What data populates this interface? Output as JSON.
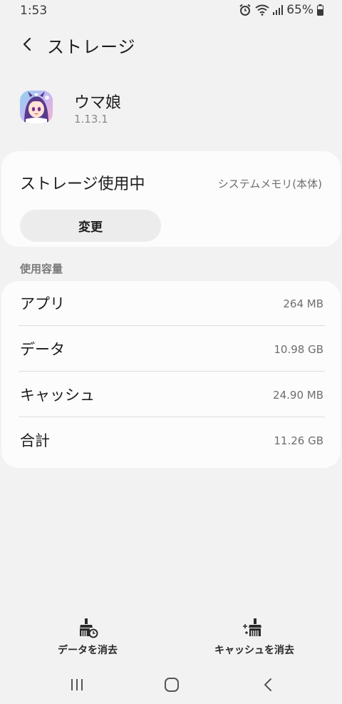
{
  "status_bar": {
    "time": "1:53",
    "battery_text": "65%",
    "icons": [
      "alarm-icon",
      "wifi-icon",
      "signal-icon",
      "battery-icon"
    ]
  },
  "header": {
    "title": "ストレージ",
    "back_icon": "chevron-left-icon"
  },
  "app": {
    "name": "ウマ娘",
    "version": "1.13.1"
  },
  "storage": {
    "label": "ストレージ使用中",
    "value": "システムメモリ(本体)",
    "change_button": "変更"
  },
  "usage": {
    "section_title": "使用容量",
    "rows": [
      {
        "label": "アプリ",
        "value": "264 MB"
      },
      {
        "label": "データ",
        "value": "10.98 GB"
      },
      {
        "label": "キャッシュ",
        "value": "24.90 MB"
      },
      {
        "label": "合計",
        "value": "11.26 GB"
      }
    ]
  },
  "actions": {
    "clear_data": "データを消去",
    "clear_cache": "キャッシュを消去"
  },
  "nav": {
    "icons": [
      "recents-icon",
      "home-icon",
      "back-icon"
    ]
  },
  "colors": {
    "background": "#f2f2f2",
    "card": "#fcfcfc",
    "button": "#ececec"
  }
}
